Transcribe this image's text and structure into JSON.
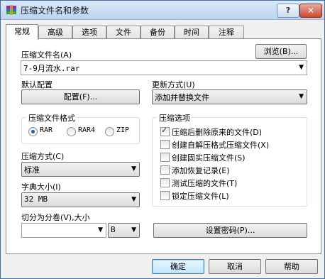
{
  "window": {
    "title": "压缩文件名和参数"
  },
  "titlebar_buttons": {
    "help": "?",
    "close": "✕"
  },
  "tabs": [
    {
      "label": "常规",
      "active": true
    },
    {
      "label": "高级"
    },
    {
      "label": "选项"
    },
    {
      "label": "文件"
    },
    {
      "label": "备份"
    },
    {
      "label": "时间"
    },
    {
      "label": "注释"
    }
  ],
  "archive_name": {
    "label": "压缩文件名(A)",
    "browse_label": "浏览(B)...",
    "value": "7-9月流水.rar"
  },
  "profile": {
    "label": "默认配置",
    "button_label": "配置(F)..."
  },
  "update_mode": {
    "label": "更新方式(U)",
    "value": "添加并替换文件"
  },
  "archive_format": {
    "title": "压缩文件格式",
    "options": [
      "RAR",
      "RAR4",
      "ZIP"
    ],
    "selected": "RAR"
  },
  "compression_method": {
    "label": "压缩方式(C)",
    "value": "标准"
  },
  "dictionary_size": {
    "label": "字典大小(I)",
    "value": "32 MB"
  },
  "split_volumes": {
    "label": "切分为分卷(V),大小",
    "value": "",
    "unit": "B"
  },
  "archive_options": {
    "title": "压缩选项",
    "items": [
      {
        "label": "压缩后删除原来的文件(D)",
        "checked": true
      },
      {
        "label": "创建自解压格式压缩文件(X)",
        "checked": false
      },
      {
        "label": "创建固实压缩文件(S)",
        "checked": false
      },
      {
        "label": "添加恢复记录(E)",
        "checked": false
      },
      {
        "label": "测试压缩的文件(T)",
        "checked": false
      },
      {
        "label": "锁定压缩文件(L)",
        "checked": false
      }
    ]
  },
  "set_password": {
    "label": "设置密码(P)..."
  },
  "footer": {
    "ok": "确定",
    "cancel": "取消",
    "help": "帮助"
  },
  "icons": {
    "app": "winrar-books-icon",
    "dropdown": "chevron-down-icon",
    "tick": "check-icon"
  }
}
